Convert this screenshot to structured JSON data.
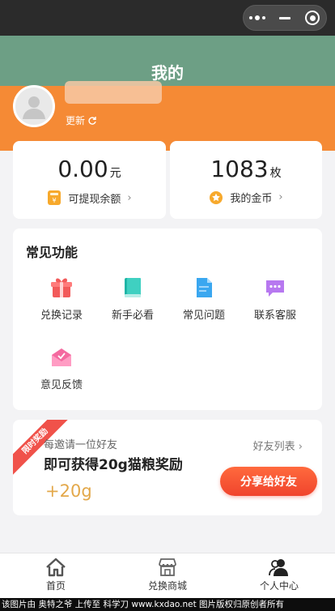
{
  "header": {
    "title": "我的",
    "refresh_label": "更新"
  },
  "user": {
    "name": ""
  },
  "stats": {
    "balance": {
      "value": "0.00",
      "unit": "元",
      "label": "可提现余额"
    },
    "coins": {
      "value": "1083",
      "unit": "枚",
      "label": "我的金币"
    }
  },
  "features": {
    "title": "常见功能",
    "items": [
      {
        "label": "兑换记录",
        "icon": "gift-icon"
      },
      {
        "label": "新手必看",
        "icon": "book-icon"
      },
      {
        "label": "常见问题",
        "icon": "document-icon"
      },
      {
        "label": "联系客服",
        "icon": "chat-icon"
      },
      {
        "label": "意见反馈",
        "icon": "envelope-icon"
      }
    ]
  },
  "invite": {
    "ribbon": "限时奖励",
    "subtitle": "每邀请一位好友",
    "title": "即可获得20g猫粮奖励",
    "reward": "+20g",
    "friend_list": "好友列表",
    "share_button": "分享给好友"
  },
  "tabbar": {
    "items": [
      {
        "label": "首页",
        "icon": "home-icon"
      },
      {
        "label": "兑换商城",
        "icon": "shop-icon"
      },
      {
        "label": "个人中心",
        "icon": "user-icon"
      }
    ]
  },
  "watermark": "该图片由 奥特之爷 上传至 科学刀 www.kxdao.net 图片版权归原创者所有",
  "colors": {
    "green": "#6d9f85",
    "orange": "#f58a35",
    "accent_red": "#f0442d",
    "gold": "#e3a84a"
  }
}
